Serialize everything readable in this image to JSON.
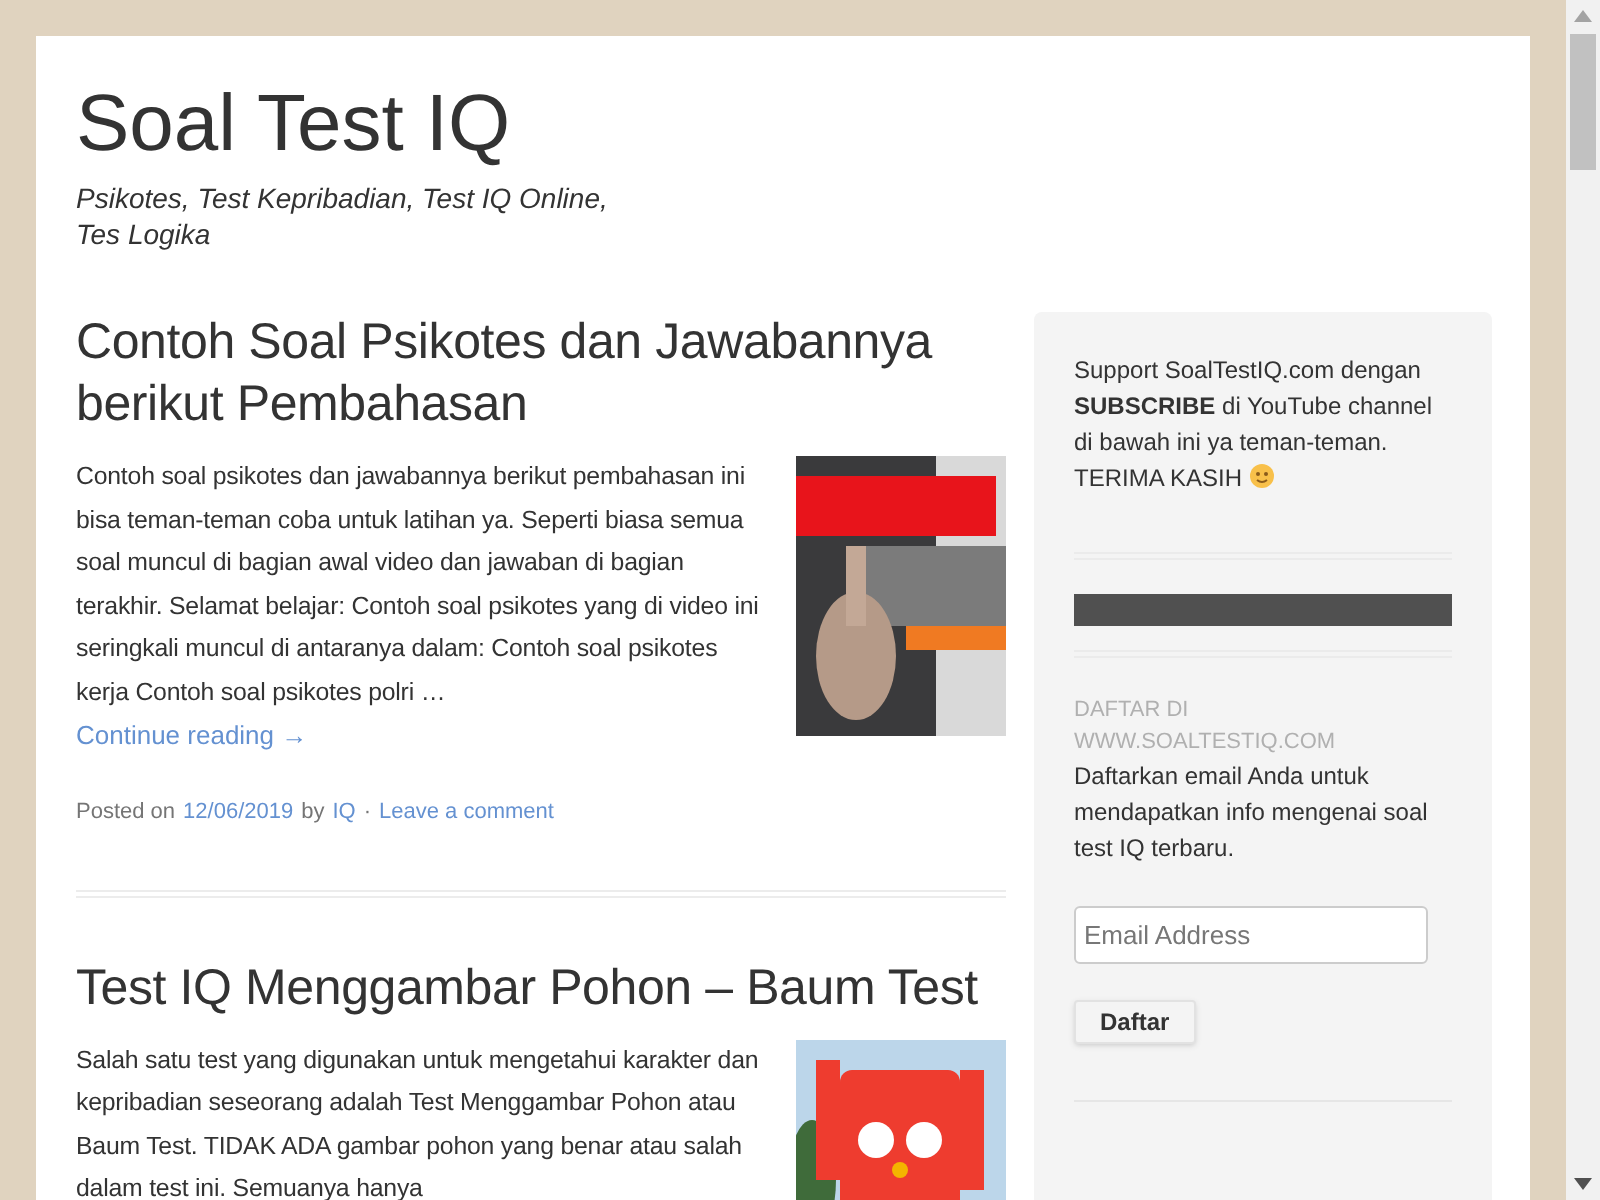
{
  "site": {
    "title": "Soal Test IQ",
    "tagline": "Psikotes, Test Kepribadian, Test IQ Online,\nTes Logika"
  },
  "posts": [
    {
      "title": "Contoh Soal Psikotes dan Jawabannya berikut Pembahasan",
      "excerpt": "Contoh soal psikotes dan jawabannya berikut pembahasan ini bisa teman-teman coba untuk latihan ya. Seperti biasa semua soal muncul di bagian awal video dan jawaban di bagian terakhir. Selamat belajar: Contoh soal psikotes yang di video ini seringkali muncul di antaranya dalam: Contoh soal psikotes kerja Contoh soal psikotes polri …",
      "continue": "Continue reading →",
      "meta": {
        "posted_on": "Posted on",
        "date": "12/06/2019",
        "by": "by",
        "author": "IQ",
        "separator": "·",
        "comments": "Leave a comment"
      }
    },
    {
      "title": "Test IQ Menggambar Pohon – Baum Test",
      "excerpt": "Salah satu test yang digunakan untuk mengetahui karakter dan kepribadian seseorang adalah Test Menggambar Pohon atau Baum Test. TIDAK ADA gambar pohon yang benar atau salah dalam test ini. Semuanya hanya"
    }
  ],
  "sidebar": {
    "support_text": "Support SoalTestIQ.com dengan **SUBSCRIBE** di YouTube channel di bawah ini ya teman-teman. TERIMA KASIH",
    "subscribe": {
      "heading": "DAFTAR DI WWW.SOALTESTIQ.COM",
      "text": "Daftarkan email Anda untuk mendapatkan info mengenai soal test IQ terbaru.",
      "placeholder": "Email Address",
      "button": "Daftar"
    }
  }
}
